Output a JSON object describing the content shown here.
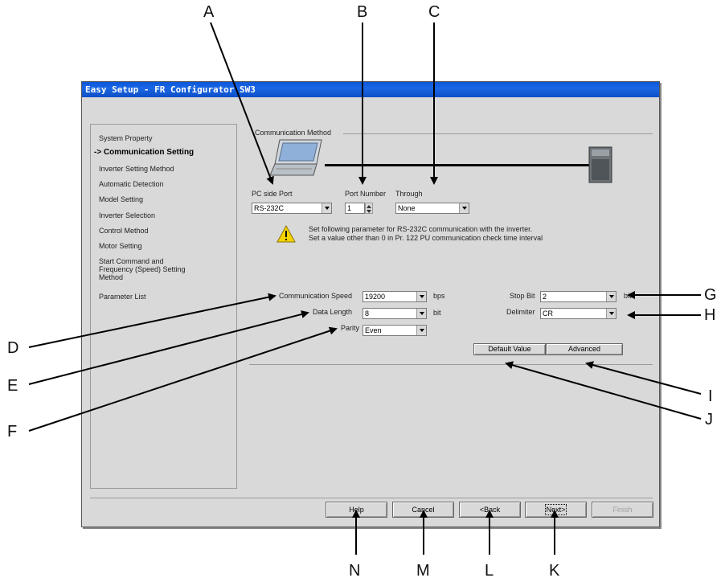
{
  "window": {
    "title": "Easy Setup - FR Configurator SW3"
  },
  "nav": {
    "items": [
      {
        "label": "System Property",
        "active": false
      },
      {
        "label": "-> Communication Setting",
        "active": true
      },
      {
        "label": "Inverter Setting Method",
        "active": false
      },
      {
        "label": "Automatic Detection",
        "active": false
      },
      {
        "label": "Model Setting",
        "active": false
      },
      {
        "label": "Inverter Selection",
        "active": false
      },
      {
        "label": "Control Method",
        "active": false
      },
      {
        "label": "Motor Setting",
        "active": false
      },
      {
        "label": "Start Command and",
        "active": false
      },
      {
        "label": "Frequency (Speed) Setting",
        "active": false
      },
      {
        "label": "Method",
        "active": false
      },
      {
        "label": "Parameter List",
        "active": false
      }
    ]
  },
  "comm": {
    "group_label": "Communication Method",
    "pc_port": {
      "label": "PC side Port",
      "value": "RS-232C"
    },
    "port_number": {
      "label": "Port Number",
      "value": "1"
    },
    "through": {
      "label": "Through",
      "value": "None"
    },
    "message_line1": "Set following parameter for RS-232C communication with the inverter.",
    "message_line2": "Set a value other than 0 in Pr. 122 PU communication check time interval",
    "speed": {
      "label": "Communication Speed",
      "value": "19200",
      "unit": "bps"
    },
    "data_length": {
      "label": "Data Length",
      "value": "8",
      "unit": "bit"
    },
    "parity": {
      "label": "Parity",
      "value": "Even"
    },
    "stop_bit": {
      "label": "Stop Bit",
      "value": "2",
      "unit": "bit"
    },
    "delimiter": {
      "label": "Delimiter",
      "value": "CR"
    },
    "default_button": "Default Value",
    "advanced_button": "Advanced"
  },
  "footer": {
    "help": "Help",
    "cancel": "Cancel",
    "back": "<Back",
    "next": "Next>",
    "finish": "Finish"
  },
  "callouts": {
    "A": "A",
    "B": "B",
    "C": "C",
    "D": "D",
    "E": "E",
    "F": "F",
    "G": "G",
    "H": "H",
    "I": "I",
    "J": "J",
    "K": "K",
    "L": "L",
    "M": "M",
    "N": "N"
  },
  "colors": {
    "titlebar": "#0a57d9",
    "dialog_bg": "#d9d9d9",
    "warning": "#f5d400"
  }
}
